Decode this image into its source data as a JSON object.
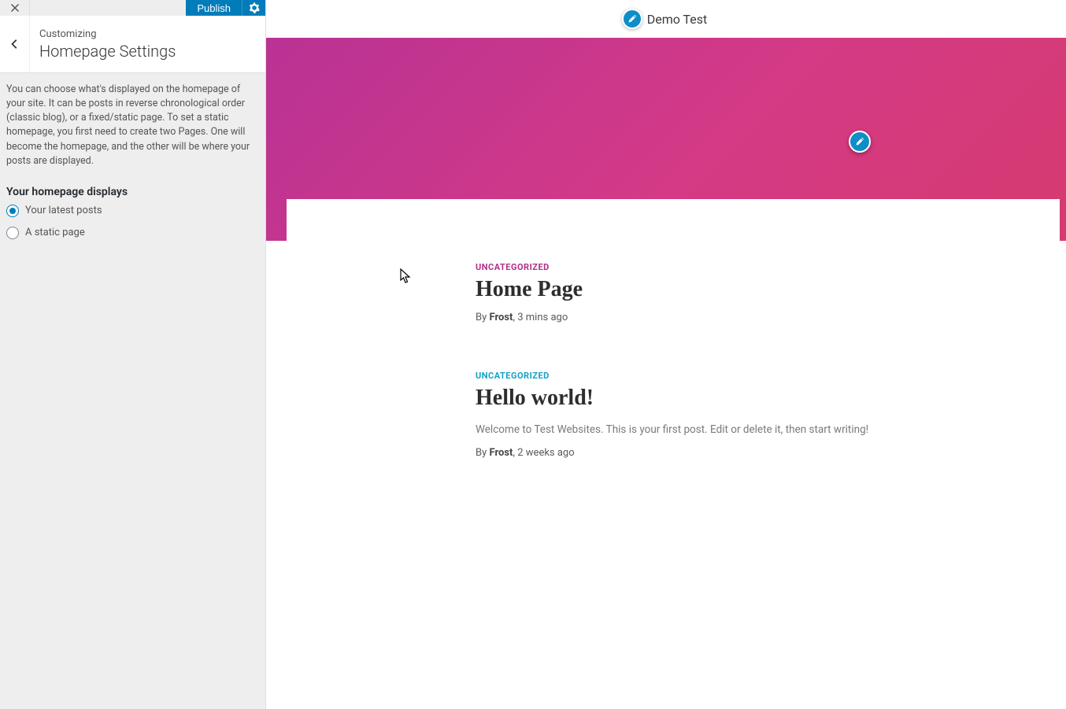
{
  "sidebar": {
    "publish_label": "Publish",
    "crumb": "Customizing",
    "title": "Homepage Settings",
    "description": "You can choose what's displayed on the homepage of your site. It can be posts in reverse chronological order (classic blog), or a fixed/static page. To set a static homepage, you first need to create two Pages. One will become the homepage, and the other will be where your posts are displayed.",
    "field_label": "Your homepage displays",
    "options": {
      "latest_posts": "Your latest posts",
      "static_page": "A static page"
    },
    "selected": "latest_posts"
  },
  "preview": {
    "site_title": "Demo Test",
    "posts": [
      {
        "category": "UNCATEGORIZED",
        "category_style": "mag",
        "title": "Home Page",
        "by_label": "By",
        "author": "Frost",
        "time": "3 mins ago",
        "excerpt": ""
      },
      {
        "category": "UNCATEGORIZED",
        "category_style": "teal",
        "title": "Hello world!",
        "by_label": "By",
        "author": "Frost",
        "time": "2 weeks ago",
        "excerpt": "Welcome to Test Websites. This is your first post. Edit or delete it, then start writing!"
      }
    ]
  }
}
